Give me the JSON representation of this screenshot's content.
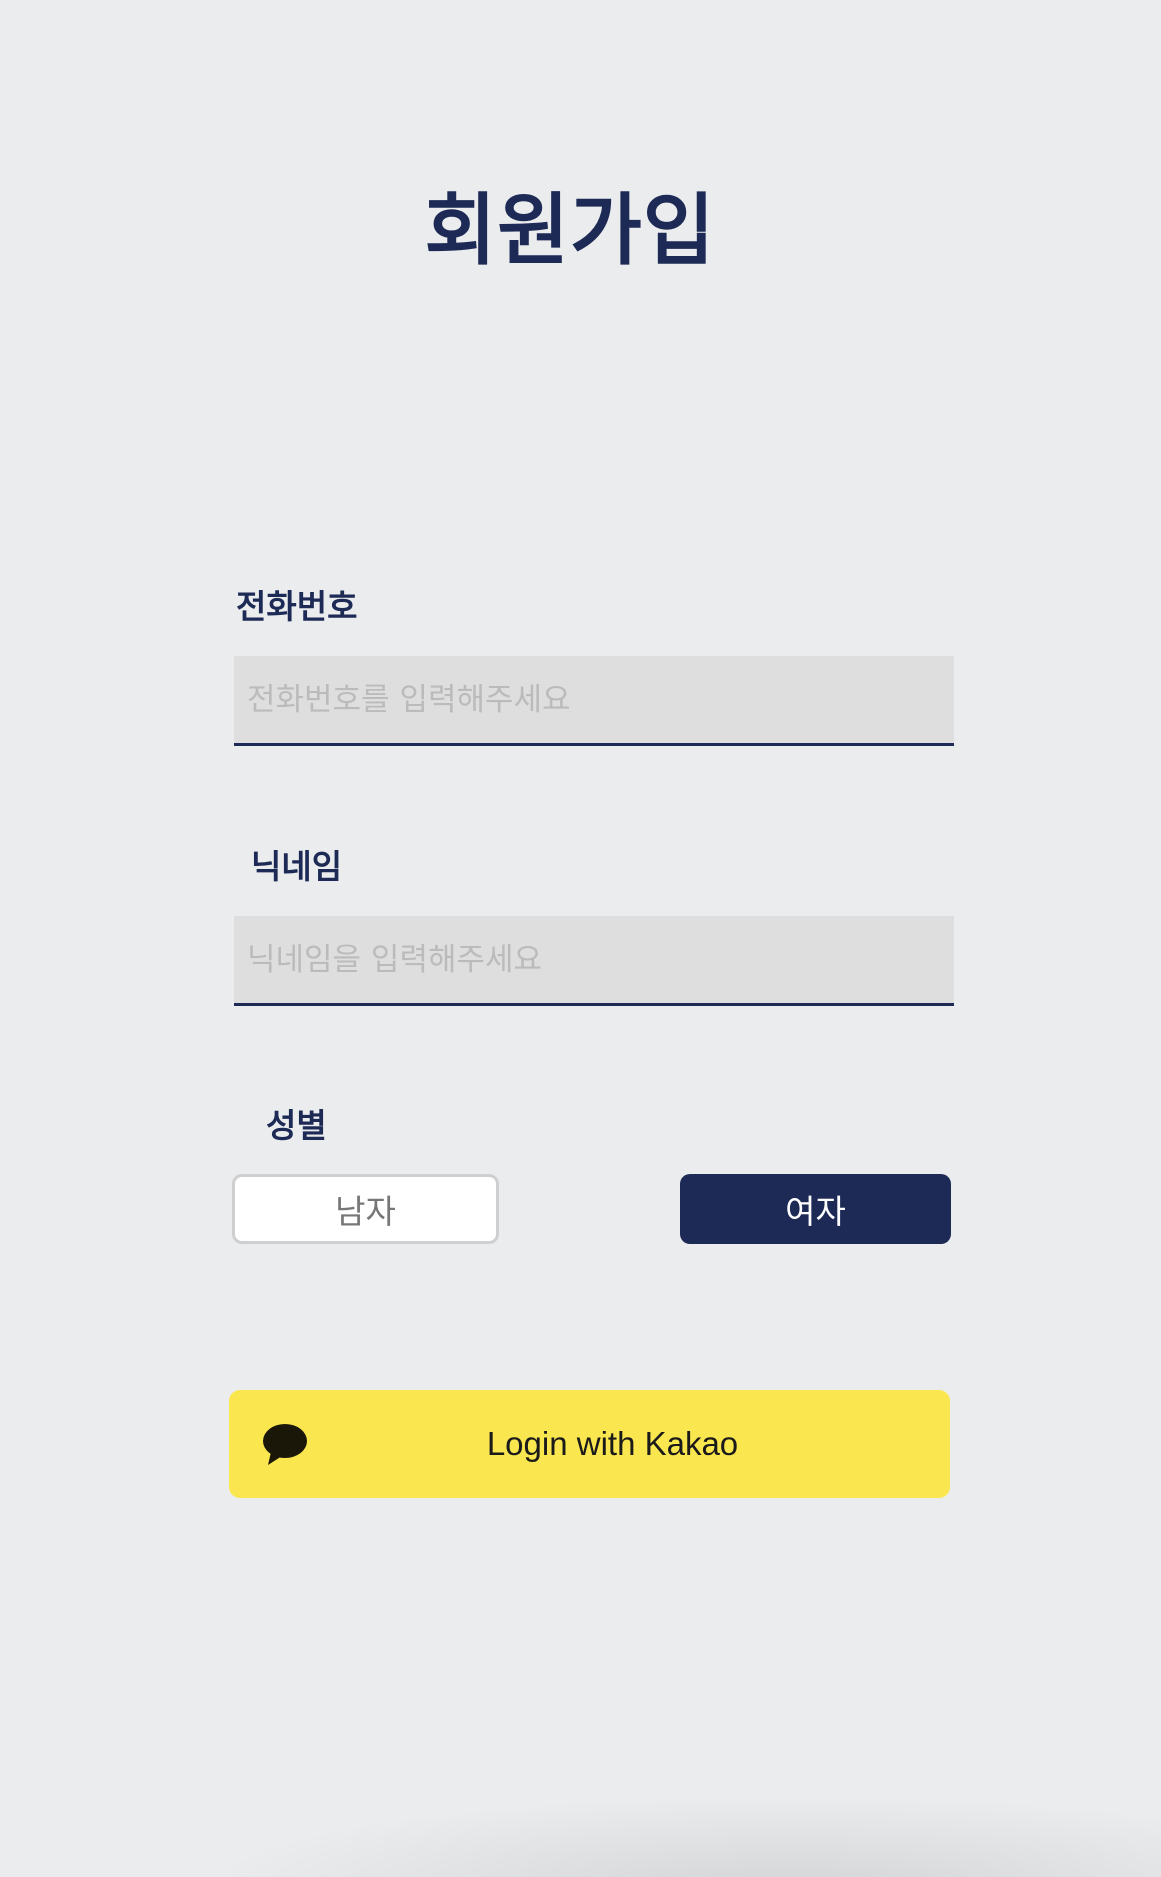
{
  "page": {
    "title": "회원가입"
  },
  "phone": {
    "label": "전화번호",
    "value": "",
    "placeholder": "전화번호를 입력해주세요"
  },
  "nickname": {
    "label": "닉네임",
    "value": "",
    "placeholder": "닉네임을 입력해주세요"
  },
  "gender": {
    "label": "성별",
    "options": [
      {
        "label": "남자",
        "selected": false
      },
      {
        "label": "여자",
        "selected": true
      }
    ]
  },
  "kakao": {
    "button_label": "Login with Kakao",
    "icon": "speech-bubble-icon"
  },
  "colors": {
    "primary": "#1c2a55",
    "background": "#ebeced",
    "input_background": "#dedede",
    "kakao_yellow": "#fae64e",
    "placeholder": "#bbbbbb"
  }
}
